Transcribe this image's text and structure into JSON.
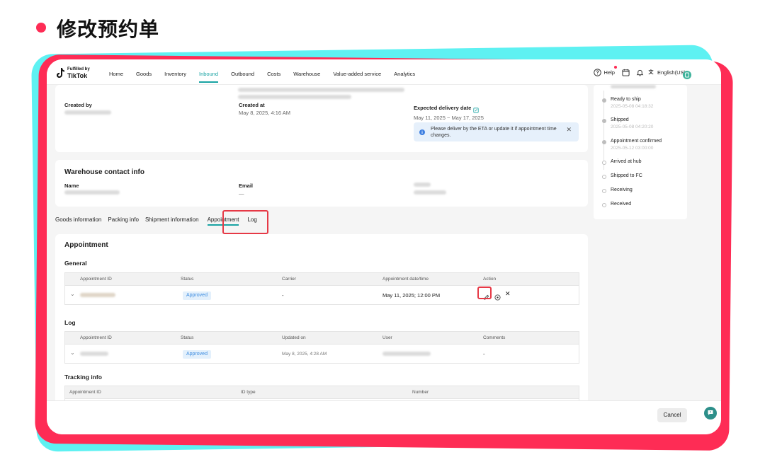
{
  "slide": {
    "title": "修改预约单"
  },
  "nav": {
    "logo_top": "Fulfilled by",
    "logo_bottom": "TikTok",
    "items": [
      "Home",
      "Goods",
      "Inventory",
      "Inbound",
      "Outbound",
      "Costs",
      "Warehouse",
      "Value-added service",
      "Analytics"
    ],
    "active": "Inbound",
    "help": "Help",
    "language": "English(US)"
  },
  "order": {
    "created_by_label": "Created by",
    "created_at_label": "Created at",
    "created_at_value": "May 8, 2025, 4:16 AM",
    "expected_label": "Expected delivery date",
    "expected_value": "May 11, 2025 ~ May 17, 2025",
    "notice": "Please deliver by the ETA or update it if appointment time changes."
  },
  "contact": {
    "title": "Warehouse contact info",
    "name_label": "Name",
    "email_label": "Email",
    "email_value": "—"
  },
  "tabs": [
    "Goods information",
    "Packing info",
    "Shipment information",
    "Appointment",
    "Log"
  ],
  "active_tab": "Appointment",
  "appointment": {
    "title": "Appointment",
    "general": {
      "title": "General",
      "columns": [
        "Appointment ID",
        "Status",
        "Carrier",
        "Appointment date/time",
        "Action"
      ],
      "row": {
        "status": "Approved",
        "carrier": "-",
        "datetime": "May 11, 2025; 12:00 PM"
      }
    },
    "log": {
      "title": "Log",
      "columns": [
        "Appointment ID",
        "Status",
        "Updated on",
        "User",
        "Comments"
      ],
      "row": {
        "status": "Approved",
        "updated_on": "May 8, 2025, 4:28 AM",
        "comments": "-"
      }
    },
    "tracking": {
      "title": "Tracking info",
      "columns": [
        "Appointment ID",
        "ID type",
        "Number"
      ]
    }
  },
  "timeline": {
    "items": [
      {
        "label": "Ready to ship",
        "time": "2025-05-08 04:18:32",
        "done": true
      },
      {
        "label": "Shipped",
        "time": "2025-05-08 04:20:20",
        "done": true
      },
      {
        "label": "Appointment confirmed",
        "time": "2025-05-12 03:00:00",
        "done": true
      },
      {
        "label": "Arrived at hub",
        "time": "",
        "done": false
      },
      {
        "label": "Shipped to FC",
        "time": "",
        "done": false
      },
      {
        "label": "Receiving",
        "time": "",
        "done": false
      },
      {
        "label": "Received",
        "time": "",
        "done": false
      }
    ]
  },
  "footer": {
    "cancel": "Cancel"
  },
  "colors": {
    "accent": "#19a3a3",
    "tiktok_red": "#fe2c55",
    "tiktok_cyan": "#5ef1f2",
    "tag_blue": "#3d8ce0"
  }
}
